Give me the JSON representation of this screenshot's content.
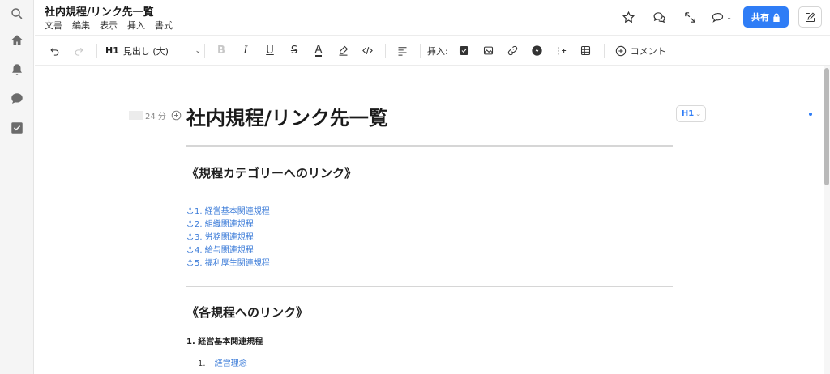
{
  "header": {
    "title": "社内規程/リンク先一覧",
    "menu": [
      "文書",
      "編集",
      "表示",
      "挿入",
      "書式"
    ],
    "share_label": "共有"
  },
  "toolbar": {
    "heading_tag": "H1",
    "heading_label": "見出し (大)",
    "insert_label": "挿入:",
    "comment_label": "コメント"
  },
  "document": {
    "meta_time": "24 分",
    "block_type": "H1",
    "title": "社内規程/リンク先一覧",
    "section1_heading": "《規程カテゴリーへのリンク》",
    "category_links": [
      "1. 経営基本関連規程",
      "2. 組織関連規程",
      "3. 労務関連規程",
      "4. 給与関連規程",
      "5. 福利厚生関連規程"
    ],
    "section2_heading": "《各規程へのリンク》",
    "subheading": "1. 経営基本関連規程",
    "list_item_number": "1.",
    "list_item_text": "経営理念"
  }
}
